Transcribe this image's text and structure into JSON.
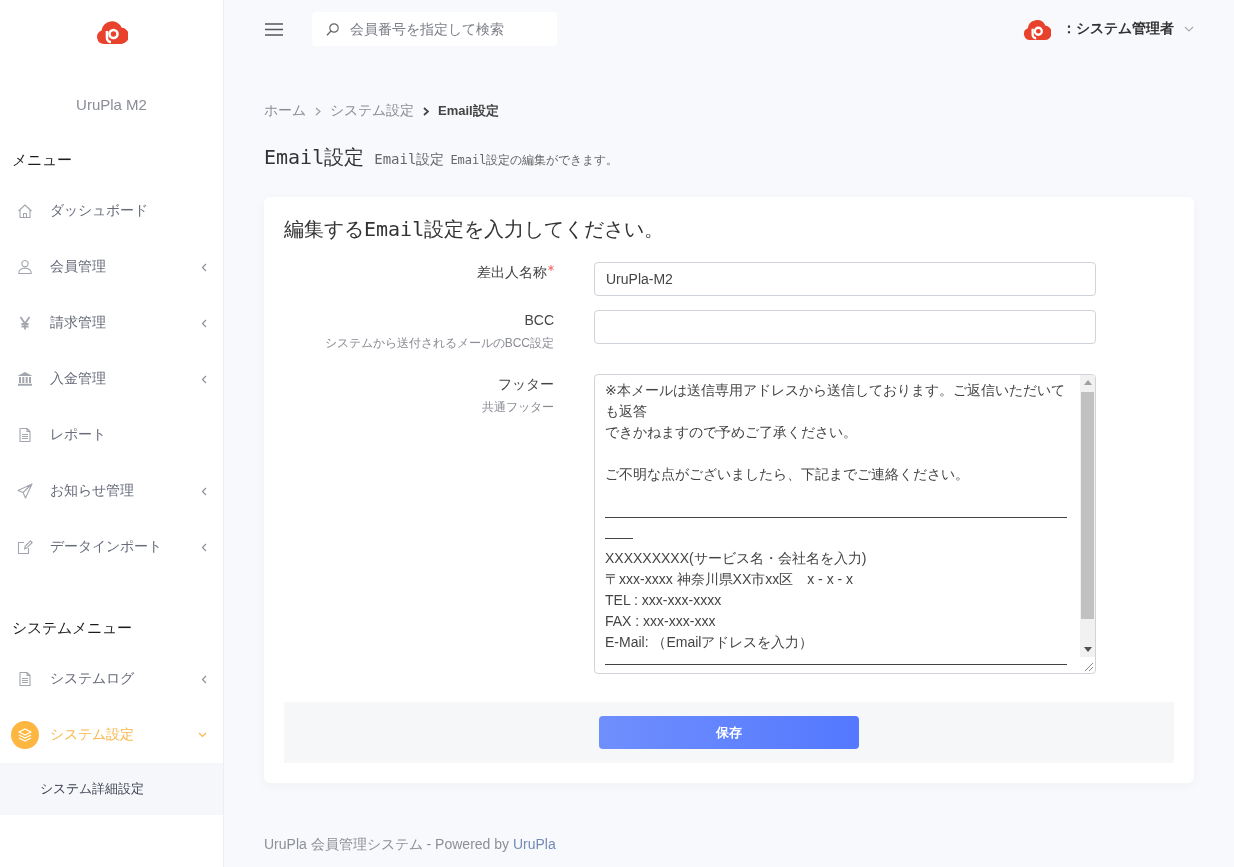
{
  "sidebar": {
    "app_name": "UruPla M2",
    "sections": [
      {
        "heading": "メニュー",
        "items": [
          {
            "label": "ダッシュボード",
            "expandable": false,
            "expanded": false,
            "selected": false
          },
          {
            "label": "会員管理",
            "expandable": true,
            "expanded": false,
            "selected": false
          },
          {
            "label": "請求管理",
            "expandable": true,
            "expanded": false,
            "selected": false
          },
          {
            "label": "入金管理",
            "expandable": true,
            "expanded": false,
            "selected": false
          },
          {
            "label": "レポート",
            "expandable": false,
            "expanded": false,
            "selected": false
          },
          {
            "label": "お知らせ管理",
            "expandable": true,
            "expanded": false,
            "selected": false
          },
          {
            "label": "データインポート",
            "expandable": true,
            "expanded": false,
            "selected": false
          }
        ]
      },
      {
        "heading": "システムメニュー",
        "items": [
          {
            "label": "システムログ",
            "expandable": true,
            "expanded": false,
            "selected": false
          },
          {
            "label": "システム設定",
            "expandable": true,
            "expanded": true,
            "selected": true,
            "children": [
              {
                "label": "システム詳細設定"
              }
            ]
          }
        ]
      }
    ]
  },
  "topbar": {
    "search": {
      "placeholder": "会員番号を指定して検索"
    },
    "user": {
      "name": "：システム管理者"
    }
  },
  "breadcrumb": [
    {
      "label": "ホーム",
      "current": false
    },
    {
      "label": "システム設定",
      "current": false
    },
    {
      "label": "Email設定",
      "current": true
    }
  ],
  "page_header": {
    "title": "Email設定",
    "subtitle": "Email設定",
    "description": "Email設定の編集ができます。"
  },
  "form": {
    "heading": "編集するEmail設定を入力してください。",
    "fields": [
      {
        "kind": "input",
        "label": "差出人名称",
        "required": true,
        "value": "UruPla-M2"
      },
      {
        "kind": "input",
        "label": "BCC",
        "hint": "システムから送付されるメールのBCC設定",
        "required": false
      },
      {
        "kind": "textarea",
        "label": "フッター",
        "hint": "共通フッター",
        "required": false,
        "paragraphs": [
          [
            "※本メールは送信専用アドレスから送信しております。ご返信いただいても返答",
            "できかねますので予めご了承ください。"
          ],
          [
            "ご不明な点がございましたら、下記までご連絡ください。"
          ],
          [
            "―――――――――――――――――――――――――――――――――――",
            "XXXXXXXXX(サービス名・会社名を入力)",
            "〒xxx-xxxx 神奈川県XX市xx区　x - x - x",
            "TEL : xxx-xxx-xxxx",
            "FAX : xxx-xxx-xxx",
            "E-Mail: （Emailアドレスを入力）",
            "―――――――――――――――――――――――――――――――――"
          ]
        ]
      }
    ],
    "save_button": {
      "label": "保存"
    }
  },
  "footer": {
    "text": "UruPla 会員管理システム - Powered by",
    "link": "UruPla"
  }
}
